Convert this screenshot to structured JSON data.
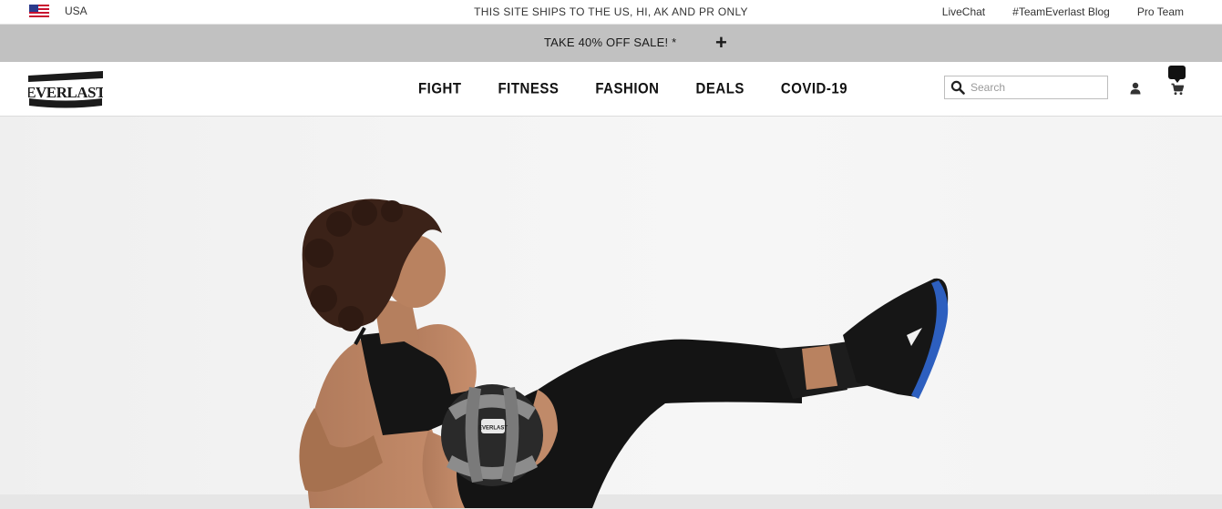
{
  "utility_bar": {
    "country_label": "USA",
    "shipping_notice": "THIS SITE SHIPS TO THE US, HI, AK AND PR ONLY",
    "links": [
      "LiveChat",
      "#TeamEverlast Blog",
      "Pro Team"
    ]
  },
  "promo_bar": {
    "text": "TAKE 40% OFF SALE! *",
    "expand_symbol": "+"
  },
  "header": {
    "logo_text": "EVERLAST",
    "nav": [
      "FIGHT",
      "FITNESS",
      "FASHION",
      "DEALS",
      "COVID-19"
    ],
    "search": {
      "placeholder": "Search",
      "value": ""
    },
    "icons": {
      "search": "search-icon",
      "account": "user-icon",
      "cart": "cart-icon",
      "cart_badge": "speech-bubble-badge"
    }
  },
  "hero": {
    "image_subject": "medicine-ball-workout",
    "ball_logo_text": "EVERLAST"
  },
  "colors": {
    "promo_background": "#c1c1c1",
    "hero_background": "#f3f3f3",
    "text": "#111111"
  }
}
